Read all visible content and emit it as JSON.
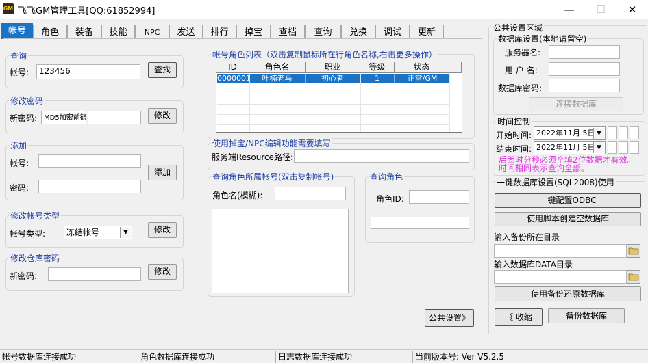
{
  "window": {
    "title": "飞飞GM管理工具[QQ:61852994]",
    "icon_text": "GM"
  },
  "tabs": [
    "帐号",
    "角色",
    "装备",
    "技能",
    "NPC",
    "发送",
    "排行",
    "掉宝",
    "查档",
    "查询",
    "兑换",
    "调试",
    "更新"
  ],
  "query": {
    "group": "查询",
    "account_label": "帐号:",
    "account_value": "123456",
    "button": "查找"
  },
  "change_password": {
    "group": "修改密码",
    "label": "新密码:",
    "value": "MD5加密前観",
    "button": "修改"
  },
  "add": {
    "group": "添加",
    "account_label": "帐号:",
    "password_label": "密码:",
    "button": "添加"
  },
  "account_type": {
    "group": "修改帐号类型",
    "label": "帐号类型:",
    "value": "冻结帐号",
    "button": "修改"
  },
  "warehouse": {
    "group": "修改仓库密码",
    "label": "新密码:",
    "button": "修改"
  },
  "role_list": {
    "group": "帐号角色列表（双击复制鼠标所在行角色名称,右击更多操作）",
    "columns": [
      "ID",
      "角色名",
      "职业",
      "等级",
      "状态"
    ],
    "rows": [
      {
        "id": "0000001",
        "name": "叶楠老马",
        "job": "初心者",
        "level": "1",
        "status": "正常/GM"
      }
    ]
  },
  "resource": {
    "group": "使用掉宝/NPC编辑功能需要填写",
    "label": "服务端Resource路径:"
  },
  "query_role_account": {
    "group": "查询角色所属帐号(双击复制帐号)",
    "label": "角色名(模糊):"
  },
  "query_role": {
    "group": "查询角色",
    "label": "角色ID:"
  },
  "public_settings_button": "公共设置》",
  "public_area": {
    "title": "公共设置区域",
    "db_group": "数据库设置(本地请留空)",
    "server_label": "服务器名:",
    "user_label": "用 户 名:",
    "password_label": "数据库密码:",
    "connect_button": "连接数据库"
  },
  "time_control": {
    "group": "时间控制",
    "start_label": "开始时间:",
    "start_value": "2022年11月 5日",
    "end_label": "结束时间:",
    "end_value": "2022年11月 5日",
    "note1": "后面时分秒必须全填2位数据才有效。",
    "note2": "时间相同表示查询全部。"
  },
  "onekey": {
    "group": "一键数据库设置(SQL2008)使用",
    "config_button": "一键配置ODBC",
    "script_button": "使用脚本创建空数据库",
    "backup_dir_label": "输入备份所在目录",
    "data_dir_label": "输入数据库DATA目录",
    "restore_button": "使用备份还原数据库",
    "collapse_button": "《 收缩",
    "backup_button": "备份数据库"
  },
  "status": [
    "帐号数据库连接成功",
    "角色数据库连接成功",
    "日志数据库连接成功",
    "当前版本号: Ver V5.2.5"
  ],
  "colors": {
    "accent": "#1a73c6",
    "group_label": "#1f3fa3",
    "note": "#e030e0"
  }
}
